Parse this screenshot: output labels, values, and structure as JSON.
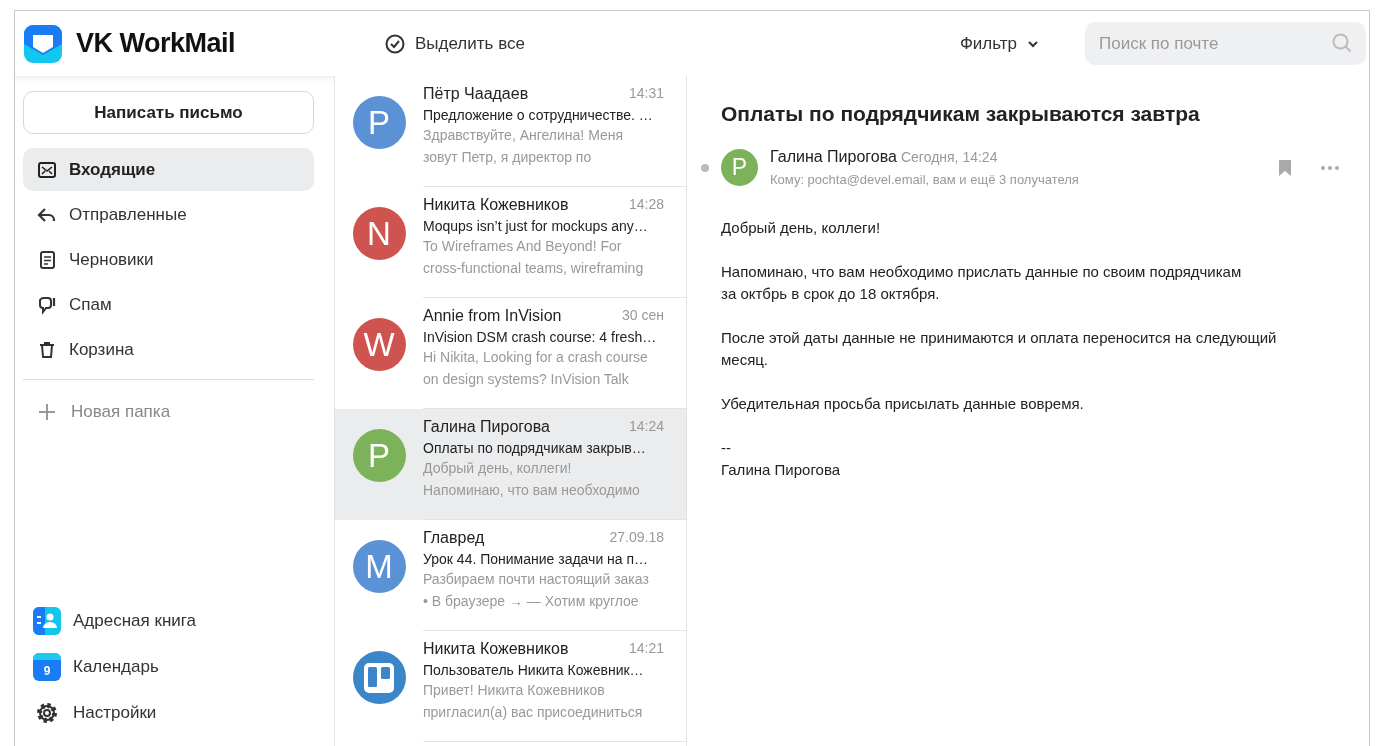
{
  "app": {
    "title": "VK WorkMail"
  },
  "toolbar": {
    "select_all": "Выделить все",
    "filter": "Фильтр",
    "search": {
      "placeholder": "Поиск по почте"
    }
  },
  "sidebar": {
    "compose": "Написать письмо",
    "folders": [
      {
        "kind": "inbox",
        "label": "Входящие",
        "selected": true
      },
      {
        "kind": "sent",
        "label": "Отправленные",
        "selected": false
      },
      {
        "kind": "drafts",
        "label": "Черновики",
        "selected": false
      },
      {
        "kind": "spam",
        "label": "Спам",
        "selected": false
      },
      {
        "kind": "trash",
        "label": "Корзина",
        "selected": false
      }
    ],
    "new_folder": "Новая папка",
    "apps": [
      {
        "kind": "contacts",
        "label": "Адресная книга"
      },
      {
        "kind": "calendar",
        "label": "Календарь",
        "badge": "9"
      },
      {
        "kind": "settings",
        "label": "Настройки"
      }
    ]
  },
  "messages": [
    {
      "kind": "letter",
      "initial": "P",
      "color": "#5b92d6",
      "sender": "Пётр Чаадаев",
      "time": "14:31",
      "subject": "Предложение о сотрудничестве. …",
      "preview": "Здравствуйте, Ангелина! Меня\nзовут Петр, я директор по",
      "selected": false
    },
    {
      "kind": "letter",
      "initial": "N",
      "color": "#cf5450",
      "sender": "Никита Кожевников",
      "time": "14:28",
      "subject": "Moqups isn’t just for mockups any…",
      "preview": "To Wireframes And Beyond! For\ncross-functional teams, wireframing",
      "selected": false
    },
    {
      "kind": "letter",
      "initial": "W",
      "color": "#cf5450",
      "sender": "Annie from InVision",
      "time": "30 сен",
      "subject": "InVision DSM crash course: 4 fresh…",
      "preview": "Hi Nikita, Looking for a crash course\non design systems? InVision Talk",
      "selected": false
    },
    {
      "kind": "letter",
      "initial": "P",
      "color": "#7cb35a",
      "sender": "Галина Пирогова",
      "time": "14:24",
      "subject": "Оплаты по подрядчикам закрыв…",
      "preview": "Добрый день, коллеги!\nНапоминаю, что вам необходимо",
      "selected": true
    },
    {
      "kind": "letter",
      "initial": "M",
      "color": "#5b92d6",
      "sender": "Главред",
      "time": "27.09.18",
      "subject": "Урок 44. Понимание задачи на п…",
      "preview": "Разбираем почти настоящий заказ\n• В браузере → — Хотим круглое",
      "selected": false
    },
    {
      "kind": "logo",
      "color": "#3a86c8",
      "sender": "Никита Кожевников",
      "time": "14:21",
      "subject": "Пользователь Никита Кожевник…",
      "preview": "Привет! Никита Кожевников\nпригласил(а) вас присоединиться",
      "selected": false
    }
  ],
  "reading": {
    "subject": "Оплаты по подрядчикам закрываются завтра",
    "initial": "P",
    "color": "#7cb35a",
    "sender": "Галина Пирогова",
    "date": "Сегодня, 14:24",
    "recipients": "Кому: pochta@devel.email, вам и ещё 3 получателя",
    "body": [
      "Добрый день, коллеги!",
      "Напоминаю, что вам необходимо прислать данные по своим подрядчикам\nза октбрь в срок до 18 октября.",
      "После этой даты данные не принимаются и оплата переносится на следующий\nмесяц.",
      "Убедительная просьба присылать данные вовремя.",
      "--\nГалина Пирогова"
    ]
  }
}
